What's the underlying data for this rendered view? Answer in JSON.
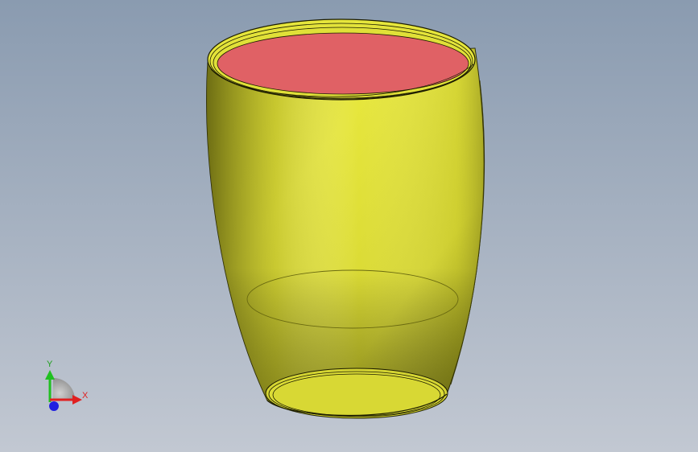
{
  "viewport": {
    "background_top": "#8a9bb0",
    "background_bottom": "#c2c8d2"
  },
  "model": {
    "body_color": "#e3e33a",
    "body_shadow": "#8c8c1a",
    "top_face_color": "#e06165",
    "edge_color": "#1c1c00"
  },
  "triad": {
    "x_label": "X",
    "y_label": "Y",
    "x_color": "#e02020",
    "y_color": "#20c020",
    "z_color": "#2020e0"
  }
}
